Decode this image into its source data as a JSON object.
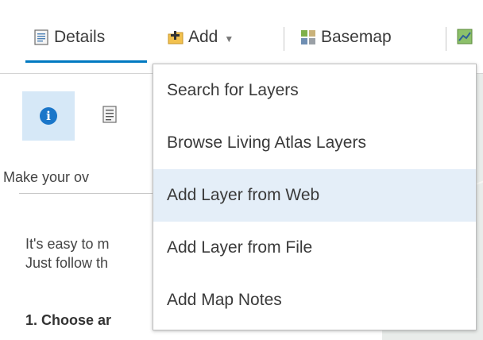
{
  "toolbar": {
    "details_label": "Details",
    "add_label": "Add",
    "basemap_label": "Basemap"
  },
  "panel": {
    "make_text": "Make your ov",
    "para_line1": "It's easy to m",
    "para_line2": "Just follow th",
    "step1": "1. Choose ar"
  },
  "dropdown": {
    "items": [
      {
        "label": "Search for Layers"
      },
      {
        "label": "Browse Living Atlas Layers"
      },
      {
        "label": "Add Layer from Web"
      },
      {
        "label": "Add Layer from File"
      },
      {
        "label": "Add Map Notes"
      }
    ],
    "active_index": 2
  },
  "colors": {
    "accent": "#0079c1",
    "hover": "#e4eef8",
    "info_bg": "#d6e8f7"
  }
}
